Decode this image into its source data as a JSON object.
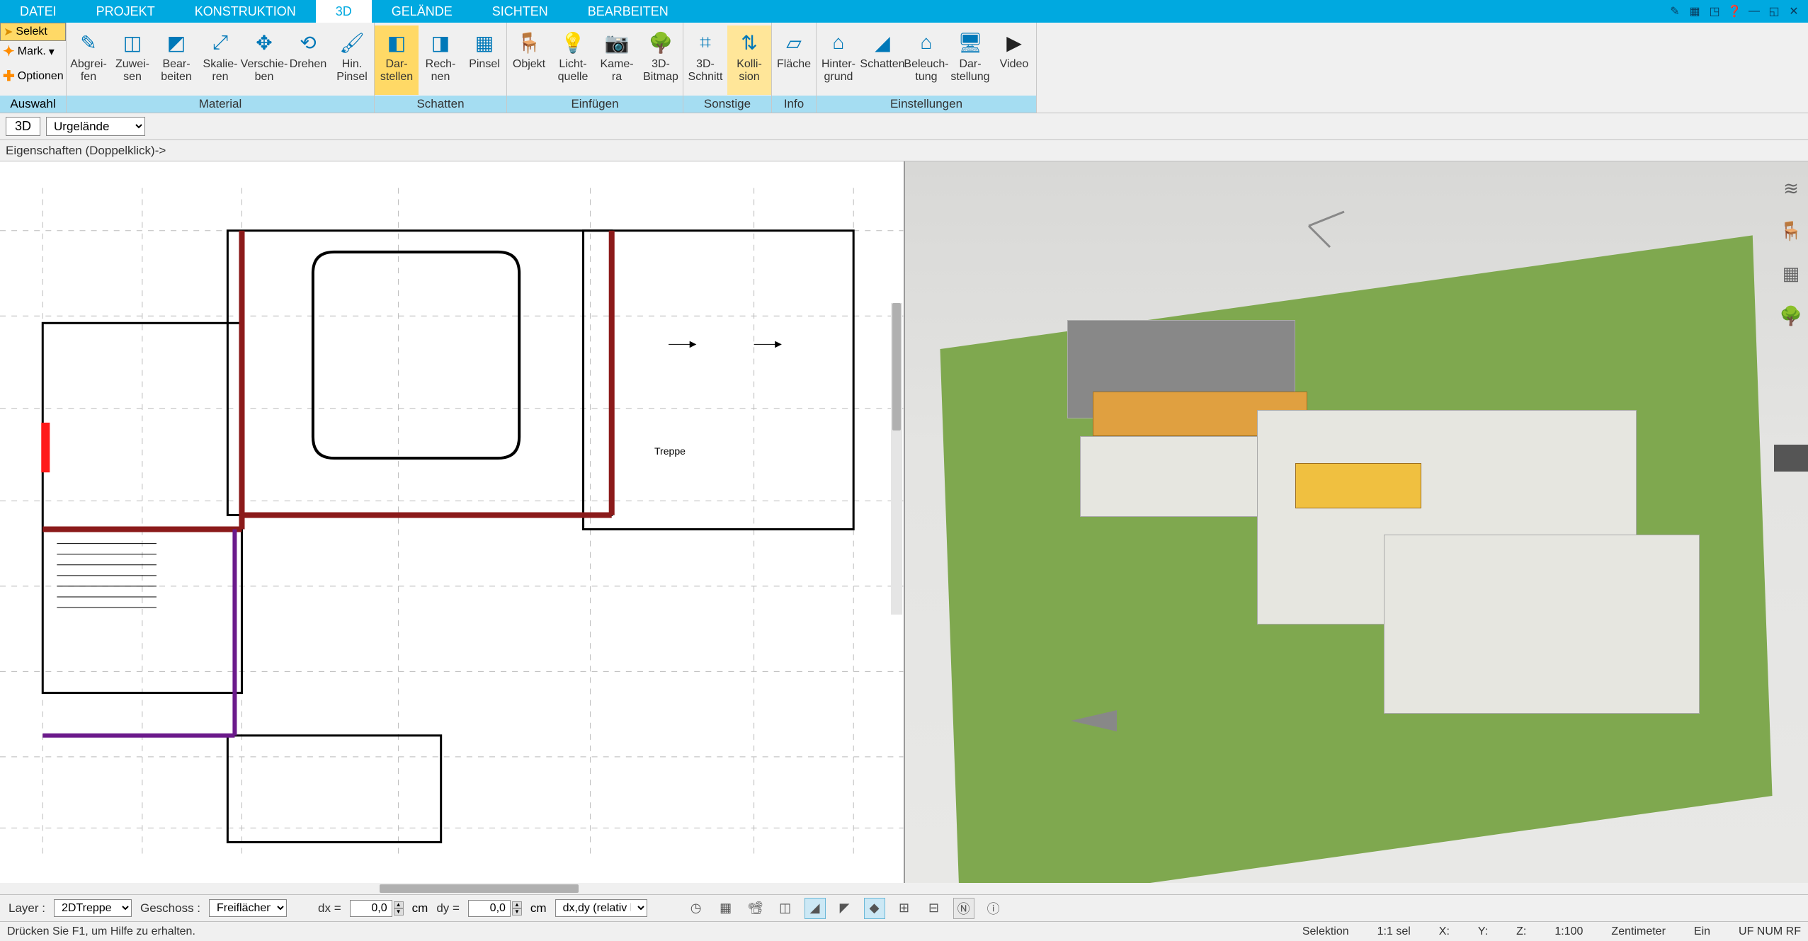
{
  "menubar": {
    "tabs": [
      "DATEI",
      "PROJEKT",
      "KONSTRUKTION",
      "3D",
      "GELÄNDE",
      "SICHTEN",
      "BEARBEITEN"
    ],
    "active_index": 3
  },
  "left_panel": {
    "select_label": "Selekt",
    "mark_label": "Mark.",
    "options_label": "Optionen",
    "group_label": "Auswahl"
  },
  "ribbon_groups": [
    {
      "label": "Material",
      "buttons": [
        {
          "label": "Abgrei-\nfen",
          "icon": "✎"
        },
        {
          "label": "Zuwei-\nsen",
          "icon": "◫"
        },
        {
          "label": "Bear-\nbeiten",
          "icon": "◩"
        },
        {
          "label": "Skalie-\nren",
          "icon": "⤢"
        },
        {
          "label": "Verschie-\nben",
          "icon": "✥"
        },
        {
          "label": "Drehen",
          "icon": "⟲"
        },
        {
          "label": "Hin.\nPinsel",
          "icon": "🖌"
        }
      ]
    },
    {
      "label": "Schatten",
      "buttons": [
        {
          "label": "Dar-\nstellen",
          "icon": "◧",
          "active": true
        },
        {
          "label": "Rech-\nnen",
          "icon": "◨"
        },
        {
          "label": "Pinsel",
          "icon": "▦"
        }
      ]
    },
    {
      "label": "Einfügen",
      "buttons": [
        {
          "label": "Objekt",
          "icon": "🪑"
        },
        {
          "label": "Licht-\nquelle",
          "icon": "💡"
        },
        {
          "label": "Kame-\nra",
          "icon": "📷"
        },
        {
          "label": "3D-\nBitmap",
          "icon": "🌳"
        }
      ]
    },
    {
      "label": "Sonstige",
      "buttons": [
        {
          "label": "3D-\nSchnitt",
          "icon": "⌗"
        },
        {
          "label": "Kolli-\nsion",
          "icon": "⇅",
          "highlight": true
        }
      ]
    },
    {
      "label": "Info",
      "buttons": [
        {
          "label": "Fläche",
          "icon": "▱"
        }
      ]
    },
    {
      "label": "Einstellungen",
      "buttons": [
        {
          "label": "Hinter-\ngrund",
          "icon": "⌂"
        },
        {
          "label": "Schatten",
          "icon": "◢"
        },
        {
          "label": "Beleuch-\ntung",
          "icon": "⌂"
        },
        {
          "label": "Dar-\nstellung",
          "icon": "🖥"
        },
        {
          "label": "Video",
          "icon": "▶"
        }
      ]
    }
  ],
  "sub_toolbar": {
    "mode": "3D",
    "dropdown_value": "Urgelände"
  },
  "properties_hint": "Eigenschaften (Doppelklick)->",
  "plan_labels": {
    "treppe": "Treppe"
  },
  "cmdbar": {
    "layer_label": "Layer :",
    "layer_value": "2DTreppe",
    "geschoss_label": "Geschoss :",
    "geschoss_value": "Freiflächen",
    "dx_label": "dx =",
    "dx_value": "0,0",
    "dx_unit": "cm",
    "dy_label": "dy =",
    "dy_value": "0,0",
    "dy_unit": "cm",
    "hint": "dx,dy (relativ ka"
  },
  "statusbar": {
    "help": "Drücken Sie F1, um Hilfe zu erhalten.",
    "selection": "Selektion",
    "ratio": "1:1 sel",
    "x_label": "X:",
    "y_label": "Y:",
    "z_label": "Z:",
    "scale": "1:100",
    "unit": "Zentimeter",
    "ein": "Ein",
    "flags": "UF NUM RF"
  }
}
